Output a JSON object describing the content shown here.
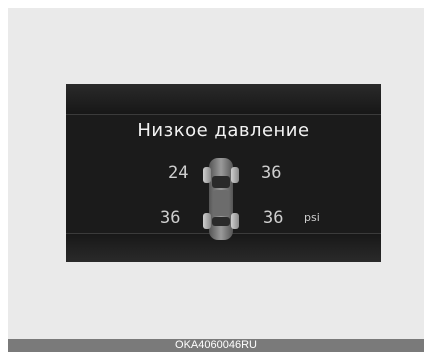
{
  "display": {
    "title": "Низкое давление",
    "pressures": {
      "front_left": "24",
      "front_right": "36",
      "rear_left": "36",
      "rear_right": "36"
    },
    "unit": "psi"
  },
  "caption": "OKA4060046RU",
  "colors": {
    "panel_background": "#1b1b1b",
    "text": "#cfcfcf",
    "caption_bar": "#7a7a7a"
  }
}
